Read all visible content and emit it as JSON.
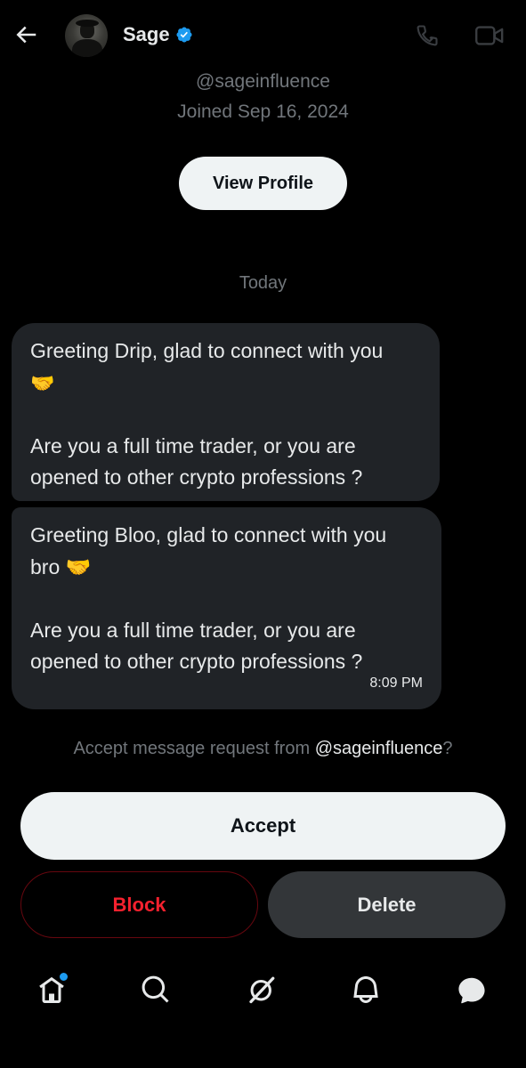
{
  "header": {
    "name": "Sage",
    "verified": true,
    "back_icon": "arrow-left-icon",
    "call_icon": "phone-icon",
    "video_icon": "video-camera-icon"
  },
  "profile": {
    "handle": "@sageinfluence",
    "joined": "Joined Sep 16, 2024",
    "view_profile_label": "View Profile"
  },
  "conversation": {
    "date_label": "Today",
    "messages": [
      {
        "line1": "Greeting Drip, glad to connect with you",
        "line2": "🤝",
        "line3": "Are you a full time trader, or you are",
        "line4": "opened to other crypto professions ?"
      },
      {
        "line1": "Greeting Bloo, glad to connect with you",
        "line2": "bro 🤝",
        "line3": "Are you a full time trader, or you are",
        "line4": "opened to other crypto professions ?",
        "time": "8:09 PM"
      }
    ]
  },
  "request": {
    "prefix": "Accept message request from ",
    "handle": "@sageinfluence",
    "suffix": "?",
    "accept_label": "Accept",
    "block_label": "Block",
    "delete_label": "Delete"
  },
  "bottom_nav": {
    "items": [
      "home-icon",
      "search-icon",
      "grok-icon",
      "notifications-bell-icon",
      "messages-icon"
    ],
    "home_has_notification_dot": true
  },
  "colors": {
    "background": "#000000",
    "bubble": "#202327",
    "accent_blue": "#1d9bf0",
    "block_red": "#f4212e",
    "muted_text": "#71767b"
  }
}
